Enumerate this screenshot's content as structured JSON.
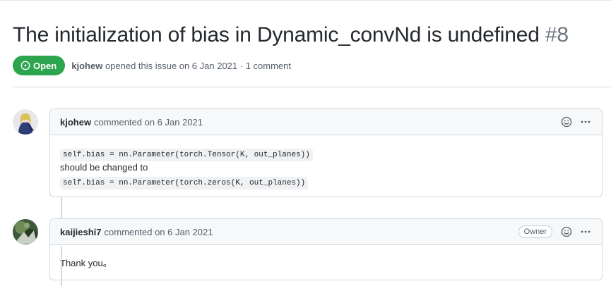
{
  "issue": {
    "title": "The initialization of bias in Dynamic_convNd is undefined",
    "number": "#8",
    "state": "Open",
    "author": "kjohew",
    "meta_text": "opened this issue on 6 Jan 2021 · 1 comment"
  },
  "comments": [
    {
      "author": "kjohew",
      "action": "commented on 6 Jan 2021",
      "body": {
        "code_1": "self.bias = nn.Parameter(torch.Tensor(K, out_planes))",
        "text_1": "should be changed to",
        "code_2": "self.bias = nn.Parameter(torch.zeros(K, out_planes))"
      }
    },
    {
      "author": "kaijieshi7",
      "action": "commented on 6 Jan 2021",
      "badge": "Owner",
      "body": {
        "text_1": "Thank you。"
      }
    }
  ],
  "icons": {
    "state": "issue-opened-icon",
    "reaction": "smiley-icon",
    "menu": "kebab-horizontal-icon"
  },
  "colors": {
    "open_green": "#2da44e",
    "header_bg": "#f6f8fa",
    "border": "#d0d7de"
  }
}
